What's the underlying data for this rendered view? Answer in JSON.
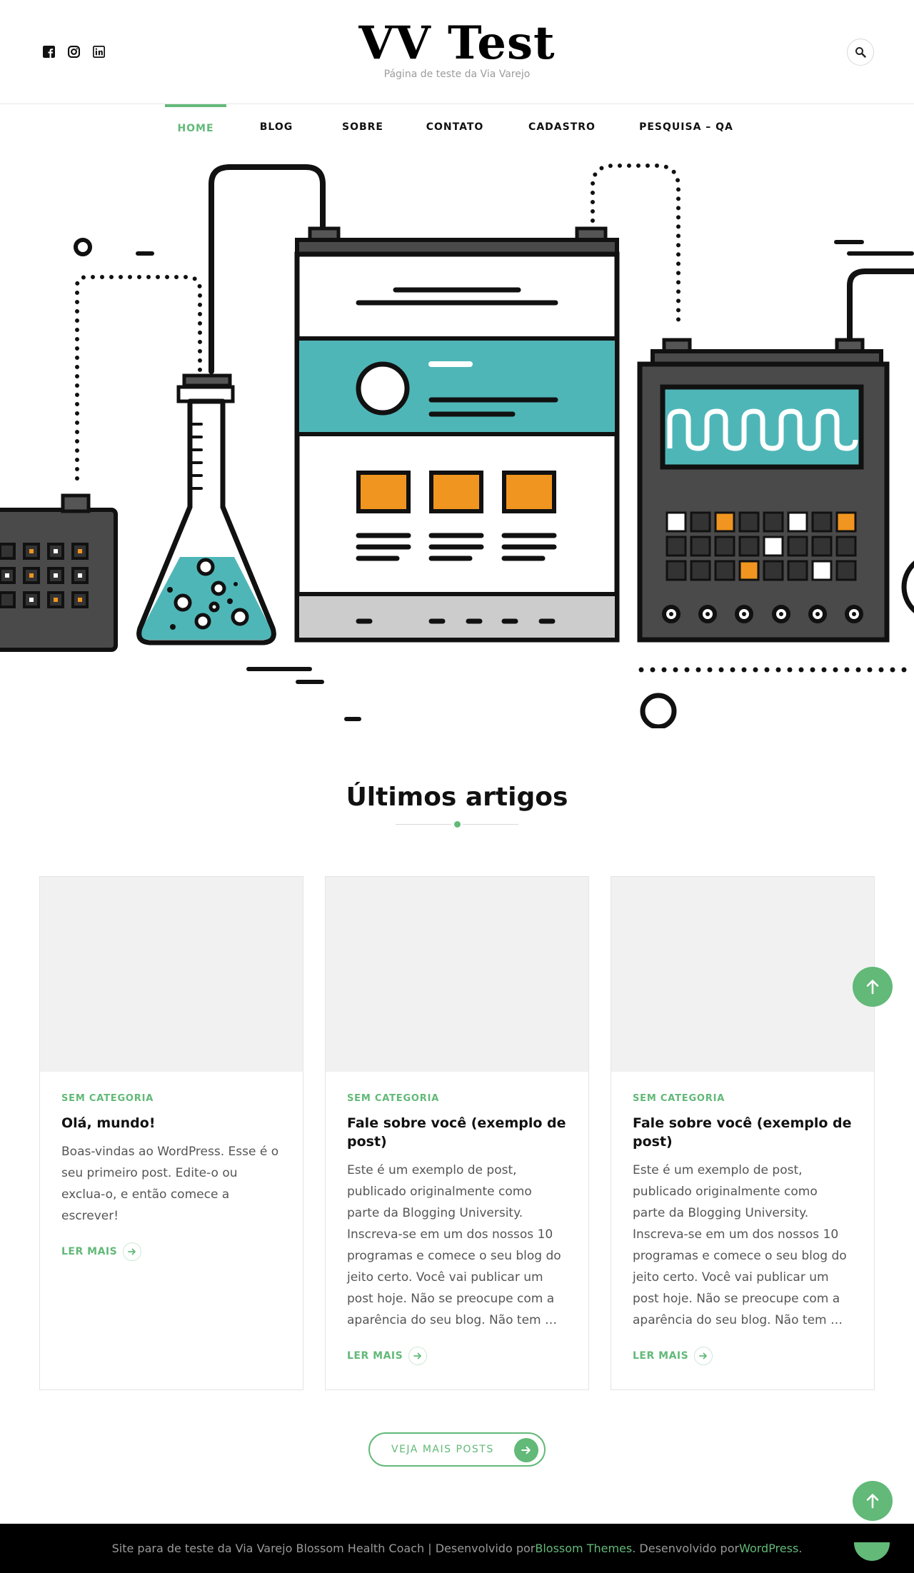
{
  "header": {
    "site_title": "VV Test",
    "site_description": "Página de teste da Via Varejo",
    "social_icons": [
      "facebook-icon",
      "instagram-icon",
      "linkedin-icon"
    ],
    "search_icon": "search-icon"
  },
  "nav": {
    "items": [
      {
        "label": "HOME",
        "active": true
      },
      {
        "label": "BLOG",
        "active": false
      },
      {
        "label": "SOBRE",
        "active": false
      },
      {
        "label": "CONTATO",
        "active": false
      },
      {
        "label": "CADASTRO",
        "active": false
      },
      {
        "label": "PESQUISA – QA",
        "active": false
      }
    ]
  },
  "section": {
    "title": "Últimos artigos"
  },
  "posts": [
    {
      "category": "SEM CATEGORIA",
      "title": "Olá, mundo!",
      "excerpt": "Boas-vindas ao WordPress. Esse é o seu primeiro post. Edite-o ou exclua-o, e então comece a escrever!",
      "read_more": "LER MAIS"
    },
    {
      "category": "SEM CATEGORIA",
      "title": "Fale sobre você (exemplo de post)",
      "excerpt": "Este é um exemplo de post, publicado originalmente como parte da Blogging University. Inscreva-se em um dos nossos 10 programas e comece o seu blog do jeito certo. Você vai publicar um post hoje. Não se preocupe com a aparência do seu blog. Não tem …",
      "read_more": "LER MAIS"
    },
    {
      "category": "SEM CATEGORIA",
      "title": "Fale sobre você (exemplo de post)",
      "excerpt": "Este é um exemplo de post, publicado originalmente como parte da Blogging University. Inscreva-se em um dos nossos 10 programas e comece o seu blog do jeito certo. Você vai publicar um post hoje. Não se preocupe com a aparência do seu blog. Não tem …",
      "read_more": "LER MAIS"
    }
  ],
  "more_posts": {
    "label": "VEJA MAIS POSTS"
  },
  "footer": {
    "prefix": "Site para de teste da Via Varejo Blossom Health Coach | Desenvolvido por ",
    "link1": "Blossom Themes",
    "middle": ". Desenvolvido por ",
    "link2": "WordPress",
    "suffix": "."
  },
  "colors": {
    "accent": "#62b978",
    "teal": "#4fb6b8",
    "orange": "#f0951f",
    "dark": "#222222"
  }
}
